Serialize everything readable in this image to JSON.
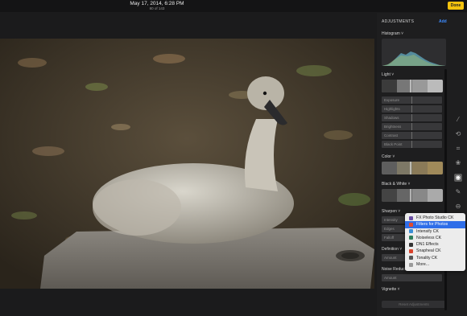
{
  "header": {
    "title": "May 17, 2014, 6:28 PM",
    "subtitle": "80 of 143",
    "done_label": "Done"
  },
  "panel": {
    "heading": "ADJUSTMENTS",
    "add_label": "Add",
    "histogram_label": "Histogram ˅",
    "light": {
      "label": "Light ˅",
      "sliders": [
        "Exposure",
        "Highlights",
        "Shadows",
        "Brightness",
        "Contrast",
        "Black Point"
      ]
    },
    "color_label": "Color ˅",
    "bw_label": "Black & White ˅",
    "sharpen": {
      "label": "Sharpen ˅",
      "sliders": [
        "Intensity",
        "Edges",
        "Falloff"
      ]
    },
    "definition": {
      "label": "Definition ˅",
      "slider": "Amount"
    },
    "noise": {
      "label": "Noise Reduction ˅",
      "slider": "Amount"
    },
    "vignette_label": "Vignette ˅",
    "reset_label": "Reset Adjustments"
  },
  "extensions_menu": {
    "items": [
      {
        "label": "FX Photo Studio CK",
        "icon": "fx-studio-icon",
        "color": "#6a4fa5",
        "selected": false
      },
      {
        "label": "Filters for Photos",
        "icon": "filters-icon",
        "color": "#e04b2f",
        "selected": true
      },
      {
        "label": "Intensify CK",
        "icon": "intensify-icon",
        "color": "#3b8fd6",
        "selected": false
      },
      {
        "label": "Noiseless CK",
        "icon": "noiseless-icon",
        "color": "#2e7d5b",
        "selected": false
      },
      {
        "label": "DN1 Effects",
        "icon": "dn1-icon",
        "color": "#333333",
        "selected": false
      },
      {
        "label": "Snapheal CK",
        "icon": "snapheal-icon",
        "color": "#d9432c",
        "selected": false
      },
      {
        "label": "Tonality CK",
        "icon": "tonality-icon",
        "color": "#555555",
        "selected": false
      },
      {
        "label": "More...",
        "icon": "more-icon",
        "color": "#9a9a9a",
        "selected": false
      }
    ]
  },
  "colors": {
    "accent": "#3d8bff",
    "done": "#f4c20d",
    "menu_selected": "#2f6ee8"
  }
}
